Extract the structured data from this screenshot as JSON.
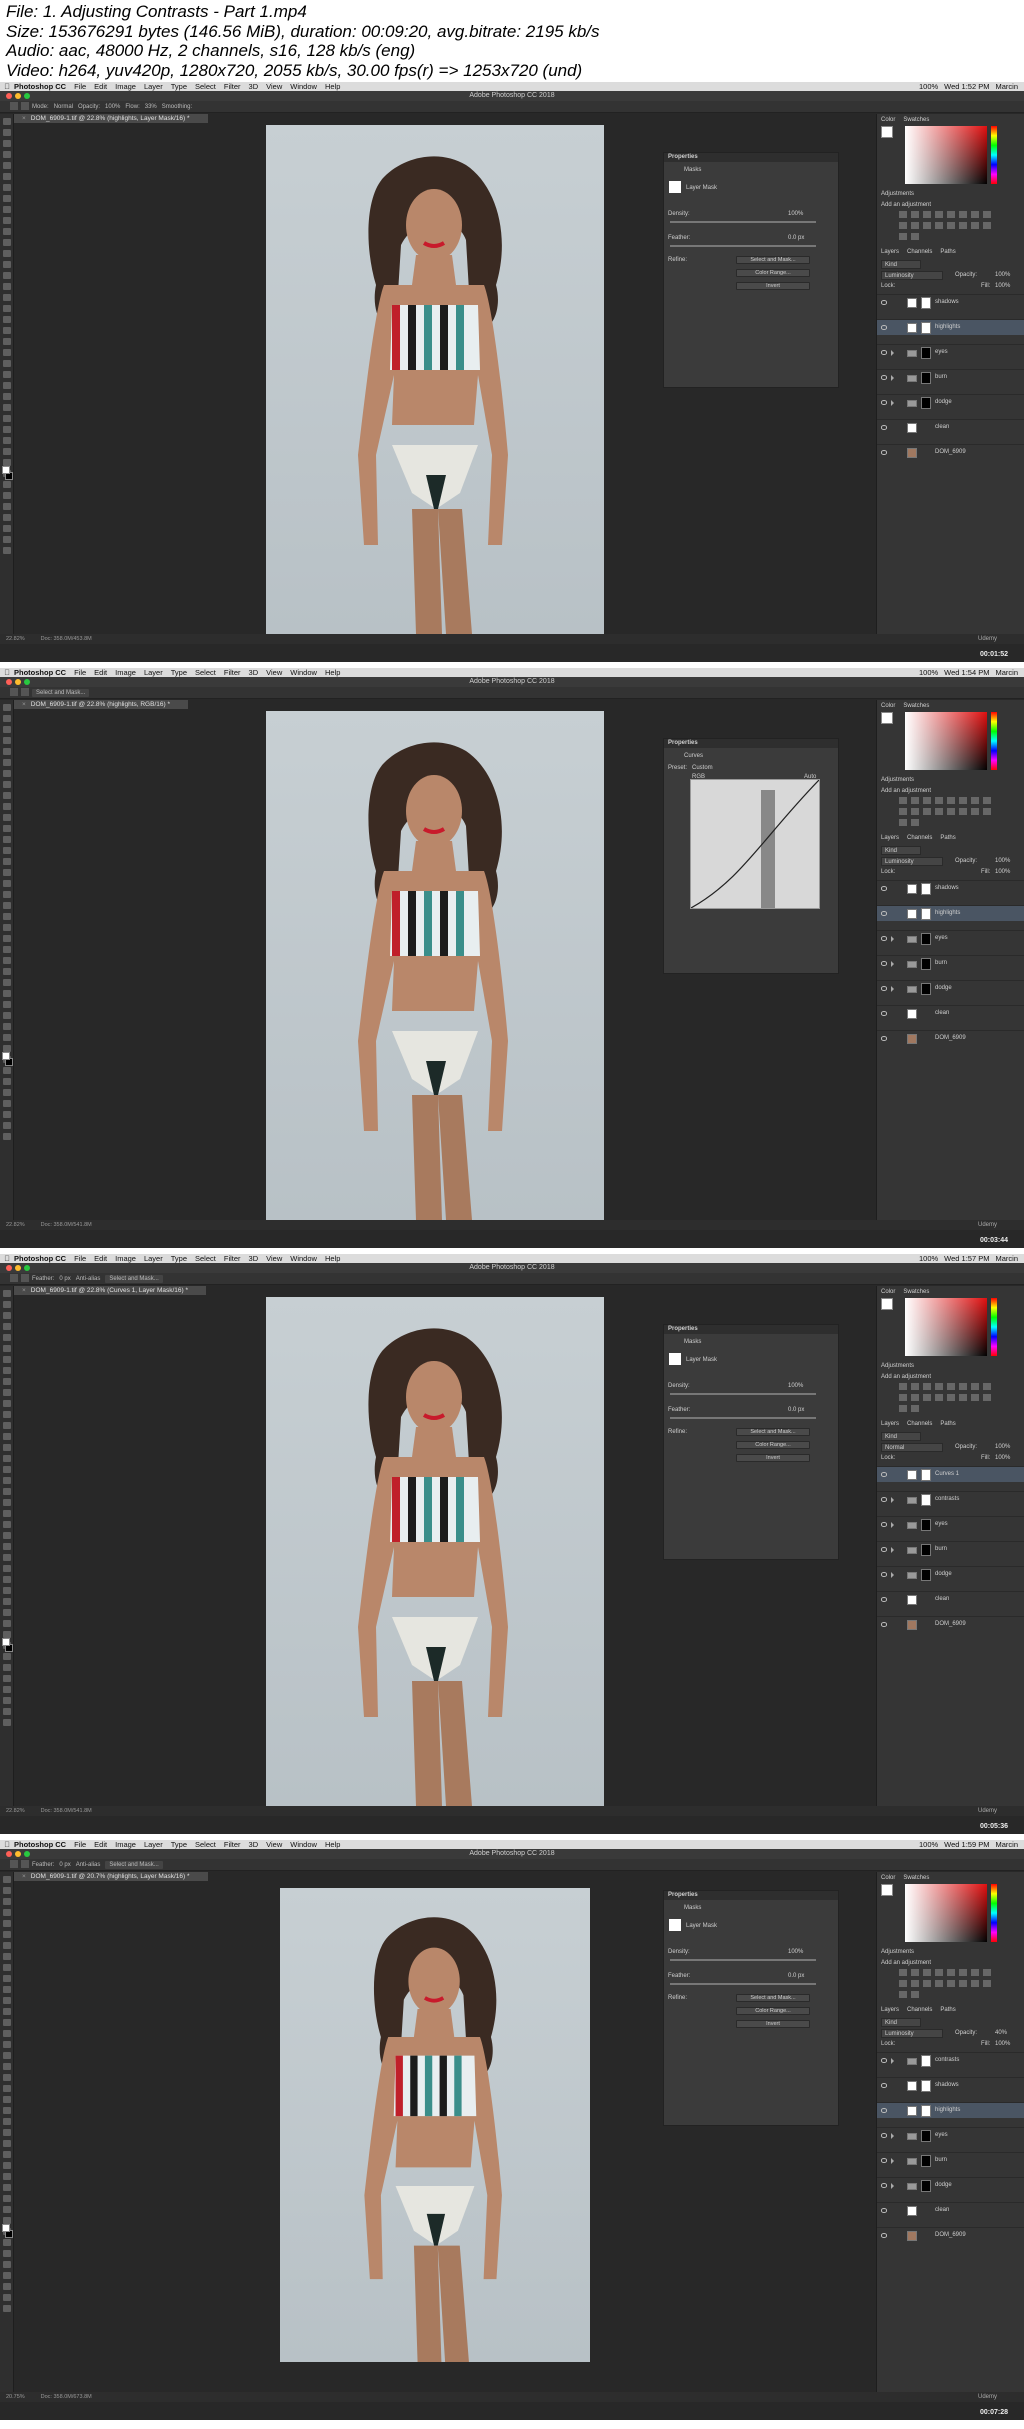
{
  "header": {
    "lines": [
      "File: 1. Adjusting Contrasts - Part 1.mp4",
      "Size: 153676291 bytes (146.56 MiB), duration: 00:09:20, avg.bitrate: 2195 kb/s",
      "Audio: aac, 48000 Hz, 2 channels, s16, 128 kb/s (eng)",
      "Video: h264, yuv420p, 1280x720, 2055 kb/s, 30.00 fps(r) => 1253x720 (und)"
    ]
  },
  "menu": {
    "app": "Photoshop CC",
    "items": [
      "File",
      "Edit",
      "Image",
      "Layer",
      "Type",
      "Select",
      "Filter",
      "3D",
      "View",
      "Window",
      "Help"
    ],
    "battery": "100%",
    "user": "Marcin"
  },
  "window_title": "Adobe Photoshop CC 2018",
  "watermark": "Udemy",
  "frames": [
    {
      "clock": "Wed 1:52 PM",
      "doc_tab": "DOM_6909-1.tif @ 22.8% (highlights, Layer Mask/16) *",
      "options": [
        "Mode:",
        "Normal",
        "Opacity:",
        "100%",
        "Flow:",
        "33%",
        "Smoothing:"
      ],
      "zoom": "22.82%",
      "doc_size": "Doc: 358.0M/453.8M",
      "timecode": "00:01:52",
      "properties": {
        "title": "Properties",
        "subtitle": "Masks",
        "mask_label": "Layer Mask",
        "density_label": "Density:",
        "density": "100%",
        "feather_label": "Feather:",
        "feather": "0.0 px",
        "refine_label": "Refine:",
        "buttons": [
          "Select and Mask...",
          "Color Range...",
          "Invert"
        ]
      },
      "layers": [
        {
          "name": "shadows",
          "type": "layer",
          "thumb": "white"
        },
        {
          "name": "highlights",
          "type": "layer",
          "thumb": "white",
          "selected": true
        },
        {
          "name": "eyes",
          "type": "folder",
          "thumb": "black"
        },
        {
          "name": "burn",
          "type": "folder",
          "thumb": "black"
        },
        {
          "name": "dodge",
          "type": "folder",
          "thumb": "black"
        },
        {
          "name": "clean",
          "type": "layer",
          "thumb": "white"
        },
        {
          "name": "DOM_6909",
          "type": "layer",
          "thumb": "photo"
        }
      ]
    },
    {
      "clock": "Wed 1:54 PM",
      "doc_tab": "DOM_6909-1.tif @ 22.8% (highlights, RGB/16) *",
      "options": [
        "Select and Mask..."
      ],
      "zoom": "22.82%",
      "doc_size": "Doc: 358.0M/541.8M",
      "timecode": "00:03:44",
      "properties": {
        "title": "Properties",
        "subtitle": "Curves",
        "preset_label": "Preset:",
        "preset": "Custom",
        "channel": "RGB",
        "auto": "Auto"
      },
      "layers": [
        {
          "name": "shadows",
          "type": "layer",
          "thumb": "white"
        },
        {
          "name": "highlights",
          "type": "layer",
          "thumb": "white",
          "selected": true
        },
        {
          "name": "eyes",
          "type": "folder",
          "thumb": "black"
        },
        {
          "name": "burn",
          "type": "folder",
          "thumb": "black"
        },
        {
          "name": "dodge",
          "type": "folder",
          "thumb": "black"
        },
        {
          "name": "clean",
          "type": "layer",
          "thumb": "white"
        },
        {
          "name": "DOM_6909",
          "type": "layer",
          "thumb": "photo"
        }
      ]
    },
    {
      "clock": "Wed 1:57 PM",
      "doc_tab": "DOM_6909-1.tif @ 22.8% (Curves 1, Layer Mask/16) *",
      "options": [
        "Feather:",
        "0 px",
        "Anti-alias",
        "Select and Mask..."
      ],
      "zoom": "22.82%",
      "doc_size": "Doc: 358.0M/541.8M",
      "timecode": "00:05:36",
      "properties": {
        "title": "Properties",
        "subtitle": "Masks",
        "mask_label": "Layer Mask",
        "density_label": "Density:",
        "density": "100%",
        "feather_label": "Feather:",
        "feather": "0.0 px",
        "refine_label": "Refine:",
        "buttons": [
          "Select and Mask...",
          "Color Range...",
          "Invert"
        ]
      },
      "layers": [
        {
          "name": "Curves 1",
          "type": "layer",
          "thumb": "white",
          "selected": true
        },
        {
          "name": "contrasts",
          "type": "folder",
          "thumb": "white"
        },
        {
          "name": "eyes",
          "type": "folder",
          "thumb": "black"
        },
        {
          "name": "burn",
          "type": "folder",
          "thumb": "black"
        },
        {
          "name": "dodge",
          "type": "folder",
          "thumb": "black"
        },
        {
          "name": "clean",
          "type": "layer",
          "thumb": "white"
        },
        {
          "name": "DOM_6909",
          "type": "layer",
          "thumb": "photo"
        }
      ]
    },
    {
      "clock": "Wed 1:59 PM",
      "doc_tab": "DOM_6909-1.tif @ 20.7% (highlights, Layer Mask/16) *",
      "options": [
        "Feather:",
        "0 px",
        "Anti-alias",
        "Select and Mask..."
      ],
      "zoom": "20.75%",
      "doc_size": "Doc: 358.0M/673.8M",
      "timecode": "00:07:28",
      "properties": {
        "title": "Properties",
        "subtitle": "Masks",
        "mask_label": "Layer Mask",
        "density_label": "Density:",
        "density": "100%",
        "feather_label": "Feather:",
        "feather": "0.0 px",
        "refine_label": "Refine:",
        "buttons": [
          "Select and Mask...",
          "Color Range...",
          "Invert"
        ]
      },
      "layers": [
        {
          "name": "contrasts",
          "type": "folder",
          "thumb": "white"
        },
        {
          "name": "shadows",
          "type": "layer",
          "thumb": "white"
        },
        {
          "name": "highlights",
          "type": "layer",
          "thumb": "white",
          "selected": true
        },
        {
          "name": "eyes",
          "type": "folder",
          "thumb": "black"
        },
        {
          "name": "burn",
          "type": "folder",
          "thumb": "black"
        },
        {
          "name": "dodge",
          "type": "folder",
          "thumb": "black"
        },
        {
          "name": "clean",
          "type": "layer",
          "thumb": "white"
        },
        {
          "name": "DOM_6909",
          "type": "layer",
          "thumb": "photo"
        }
      ]
    }
  ],
  "panels": {
    "color_tabs": [
      "Color",
      "Swatches"
    ],
    "adjustments_title": "Adjustments",
    "adjustments_hint": "Add an adjustment",
    "layers_tabs": [
      "Layers",
      "Channels",
      "Paths"
    ],
    "kind": "Kind",
    "blend_modes": [
      "Luminosity",
      "Luminosity",
      "Normal",
      "Luminosity"
    ],
    "opacity_label": "Opacity:",
    "opacity_values": [
      "100%",
      "100%",
      "100%",
      "40%"
    ],
    "lock_label": "Lock:",
    "fill_label": "Fill:",
    "fill": "100%"
  }
}
